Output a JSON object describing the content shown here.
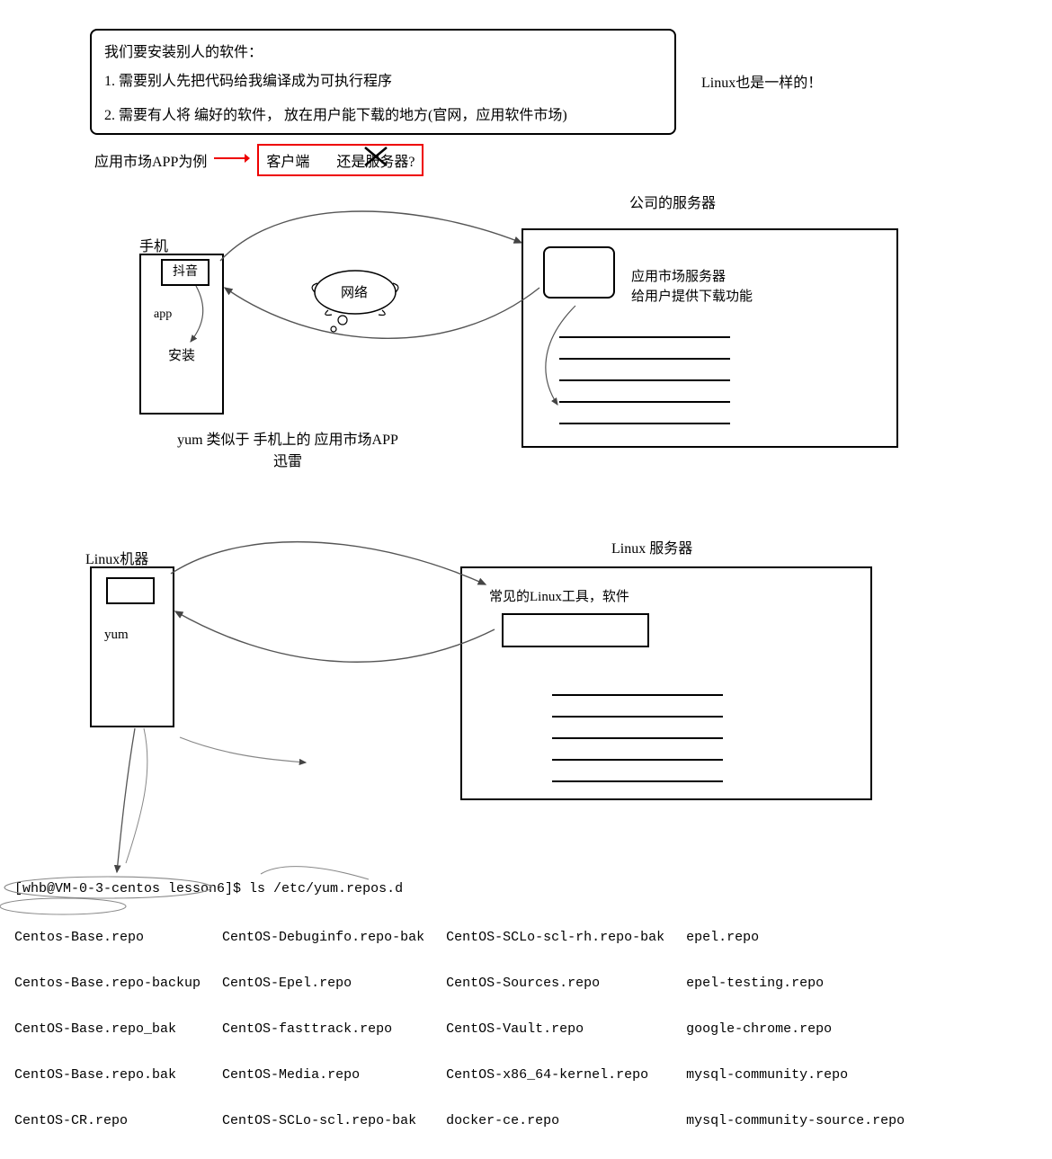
{
  "intro_box": {
    "title": "我们要安装别人的软件：",
    "item1": "1. 需要别人先把代码给我编译成为可执行程序",
    "item2": "2. 需要有人将 编好的软件， 放在用户能下载的地方(官网，应用软件市场)"
  },
  "side_note": "Linux也是一样的！",
  "example_label": "应用市场APP为例",
  "redbox": {
    "client": "客户端",
    "or_server": "还是服务器?",
    "strike_word": "服务"
  },
  "analogy_top": {
    "phone_label": "手机",
    "app_name": "抖音",
    "app_text": "app",
    "install_text": "安装",
    "network_label": "网络",
    "server_title": "公司的服务器",
    "server_box_line1": "应用市场服务器",
    "server_box_line2": "给用户提供下载功能",
    "footer_line1": "yum 类似于 手机上的 应用市场APP",
    "footer_line2": "迅雷"
  },
  "analogy_bottom": {
    "client_label": "Linux机器",
    "client_tool": "yum",
    "server_title": "Linux 服务器",
    "server_text": "常见的Linux工具，软件"
  },
  "terminal": {
    "prompt": "[whb@VM-0-3-centos lesson6]$ ls /etc/yum.repos.d",
    "col1": [
      "Centos-Base.repo",
      "Centos-Base.repo-backup",
      "CentOS-Base.repo_bak",
      "CentOS-Base.repo.bak",
      "CentOS-CR.repo"
    ],
    "col2": [
      "CentOS-Debuginfo.repo-bak",
      "CentOS-Epel.repo",
      "CentOS-fasttrack.repo",
      "CentOS-Media.repo",
      "CentOS-SCLo-scl.repo-bak"
    ],
    "col3": [
      "CentOS-SCLo-scl-rh.repo-bak",
      "CentOS-Sources.repo",
      "CentOS-Vault.repo",
      "CentOS-x86_64-kernel.repo",
      "docker-ce.repo"
    ],
    "col4": [
      "epel.repo",
      "epel-testing.repo",
      "google-chrome.repo",
      "mysql-community.repo",
      "mysql-community-source.repo"
    ]
  }
}
